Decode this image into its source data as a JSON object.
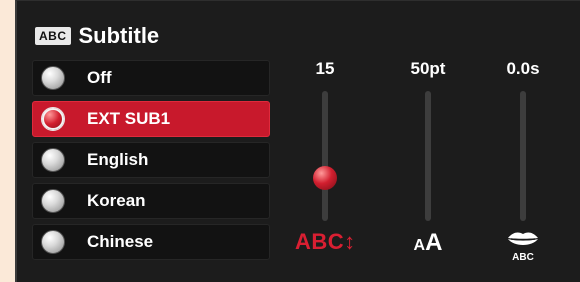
{
  "header": {
    "badge": "ABC",
    "title": "Subtitle"
  },
  "options": [
    {
      "label": "Off",
      "selected": false
    },
    {
      "label": "EXT SUB1",
      "selected": true
    },
    {
      "label": "English",
      "selected": false
    },
    {
      "label": "Korean",
      "selected": false
    },
    {
      "label": "Chinese",
      "selected": false
    }
  ],
  "sliders": {
    "position": {
      "value": "15",
      "icon": "ABC↕",
      "level": 0.2
    },
    "font_size": {
      "value": "50pt",
      "icon_small": "A",
      "icon_big": "A",
      "level": 0.0
    },
    "sync": {
      "value": "0.0s",
      "icon_label": "ABC",
      "level": 0.0
    }
  },
  "colors": {
    "accent": "#c8192c",
    "panel": "#1c1c1c"
  }
}
